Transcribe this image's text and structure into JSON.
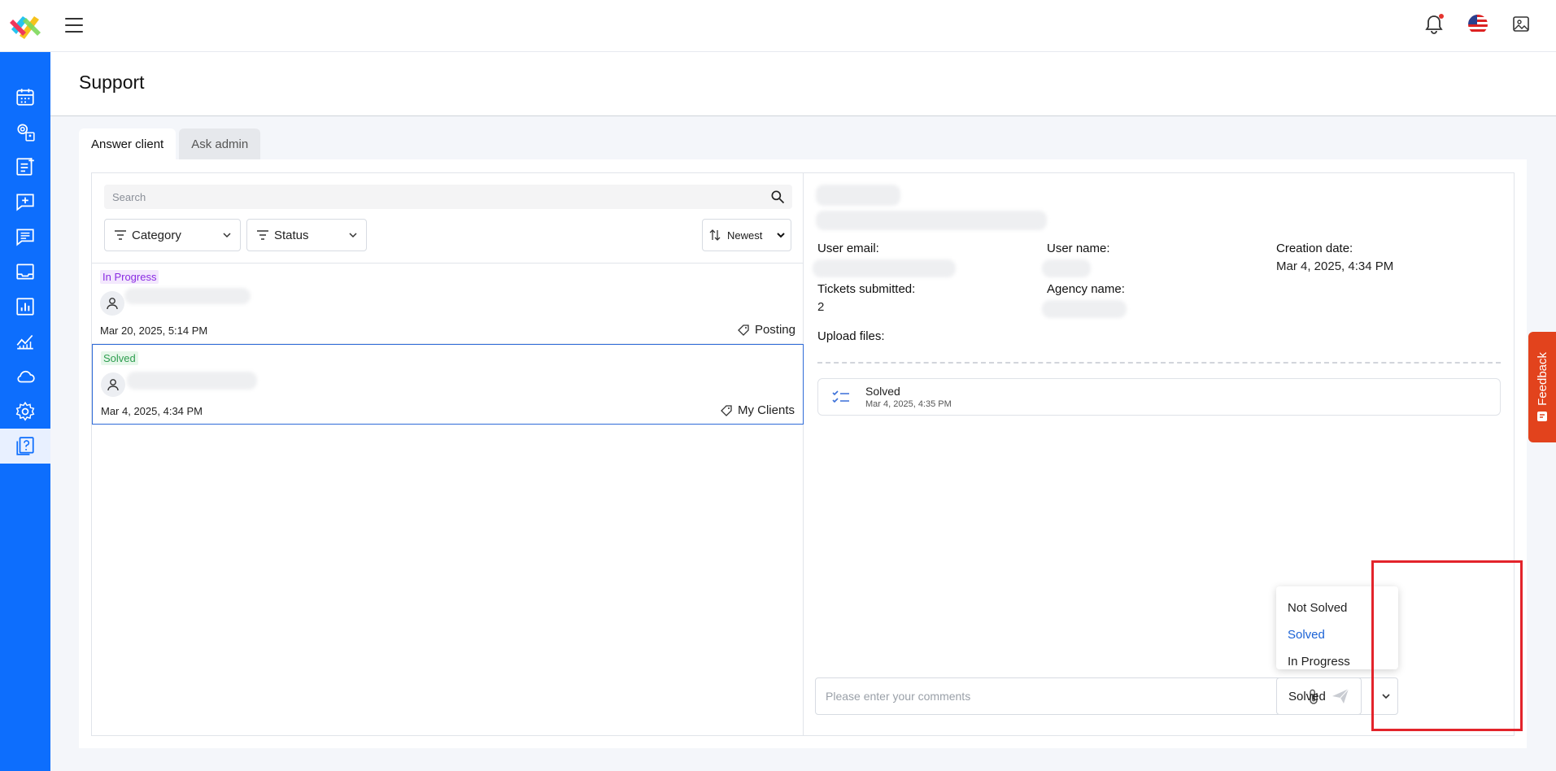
{
  "header": {
    "logo": "app-logo",
    "notification_icon": "bell-icon",
    "flag_icon": "us-flag-icon",
    "profile_icon": "profile-picture-icon"
  },
  "sidebar": {
    "items": [
      {
        "icon": "calendar-icon"
      },
      {
        "icon": "user-settings-icon"
      },
      {
        "icon": "add-post-icon"
      },
      {
        "icon": "add-chat-icon"
      },
      {
        "icon": "chat-list-icon"
      },
      {
        "icon": "inbox-icon"
      },
      {
        "icon": "report-chart-icon"
      },
      {
        "icon": "analytics-icon"
      },
      {
        "icon": "cloud-icon"
      },
      {
        "icon": "gear-icon"
      },
      {
        "icon": "help-icon",
        "active": true
      }
    ]
  },
  "page": {
    "title": "Support",
    "tabs": [
      {
        "label": "Answer client",
        "active": true
      },
      {
        "label": "Ask admin",
        "active": false
      }
    ]
  },
  "filters": {
    "search_placeholder": "Search",
    "category_label": "Category",
    "status_label": "Status",
    "sort_label": "Newest"
  },
  "tickets": [
    {
      "status": "In Progress",
      "date": "Mar 20, 2025, 5:14 PM",
      "tag": "Posting",
      "selected": false
    },
    {
      "status": "Solved",
      "date": "Mar 4, 2025, 4:34 PM",
      "tag": "My Clients",
      "selected": true
    }
  ],
  "details": {
    "user_email_label": "User email:",
    "user_name_label": "User name:",
    "creation_date_label": "Creation date:",
    "creation_date_value": "Mar 4, 2025, 4:34 PM",
    "tickets_submitted_label": "Tickets submitted:",
    "tickets_submitted_value": "2",
    "agency_name_label": "Agency name:",
    "upload_files_label": "Upload files:",
    "log_title": "Solved",
    "log_time": "Mar 4, 2025, 4:35 PM"
  },
  "comment": {
    "placeholder": "Please enter your comments"
  },
  "status_dropdown": {
    "selected": "Solved",
    "options": [
      "Not Solved",
      "Solved",
      "In Progress"
    ]
  },
  "feedback": {
    "label": "Feedback"
  },
  "colors": {
    "sidebar": "#0d6efd",
    "in_progress": "#8a2be2",
    "solved": "#2e9e4f",
    "selected_option": "#1a62d6",
    "highlight": "#e3242b",
    "feedback": "#e2431d"
  }
}
